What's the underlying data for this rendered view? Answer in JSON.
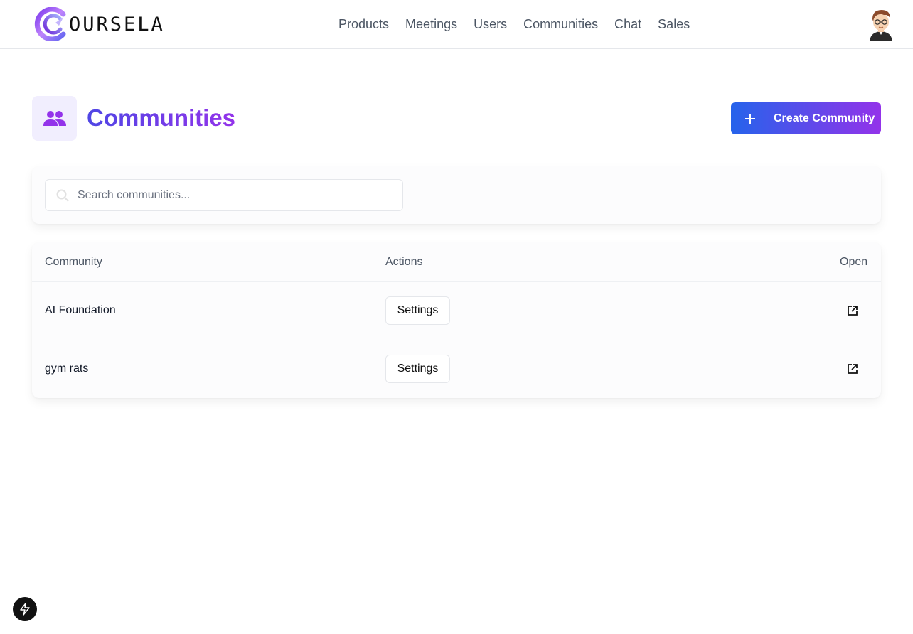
{
  "brand": {
    "logo_text": "OURSELA",
    "logo_icon": "brand-c-logo-icon"
  },
  "nav": {
    "items": [
      {
        "label": "Products"
      },
      {
        "label": "Meetings"
      },
      {
        "label": "Users"
      },
      {
        "label": "Communities"
      },
      {
        "label": "Chat"
      },
      {
        "label": "Sales"
      }
    ]
  },
  "user": {
    "avatar_icon": "user-avatar-icon"
  },
  "header": {
    "title": "Communities",
    "icon": "users-icon",
    "create_label": "Create Community",
    "create_icon": "plus-icon"
  },
  "search": {
    "placeholder": "Search communities...",
    "value": "",
    "icon": "search-icon"
  },
  "table": {
    "columns": [
      "Community",
      "Actions",
      "Open"
    ],
    "rows": [
      {
        "name": "AI Foundation",
        "action_label": "Settings",
        "open_icon": "external-link-icon"
      },
      {
        "name": "gym rats",
        "action_label": "Settings",
        "open_icon": "external-link-icon"
      }
    ]
  },
  "dev_indicator": {
    "icon": "lightning-bolt-icon"
  },
  "colors": {
    "accent_start": "#2563eb",
    "accent_end": "#9333ea",
    "title_start": "#4f46e5",
    "icon_bg": "#f1eefe"
  }
}
